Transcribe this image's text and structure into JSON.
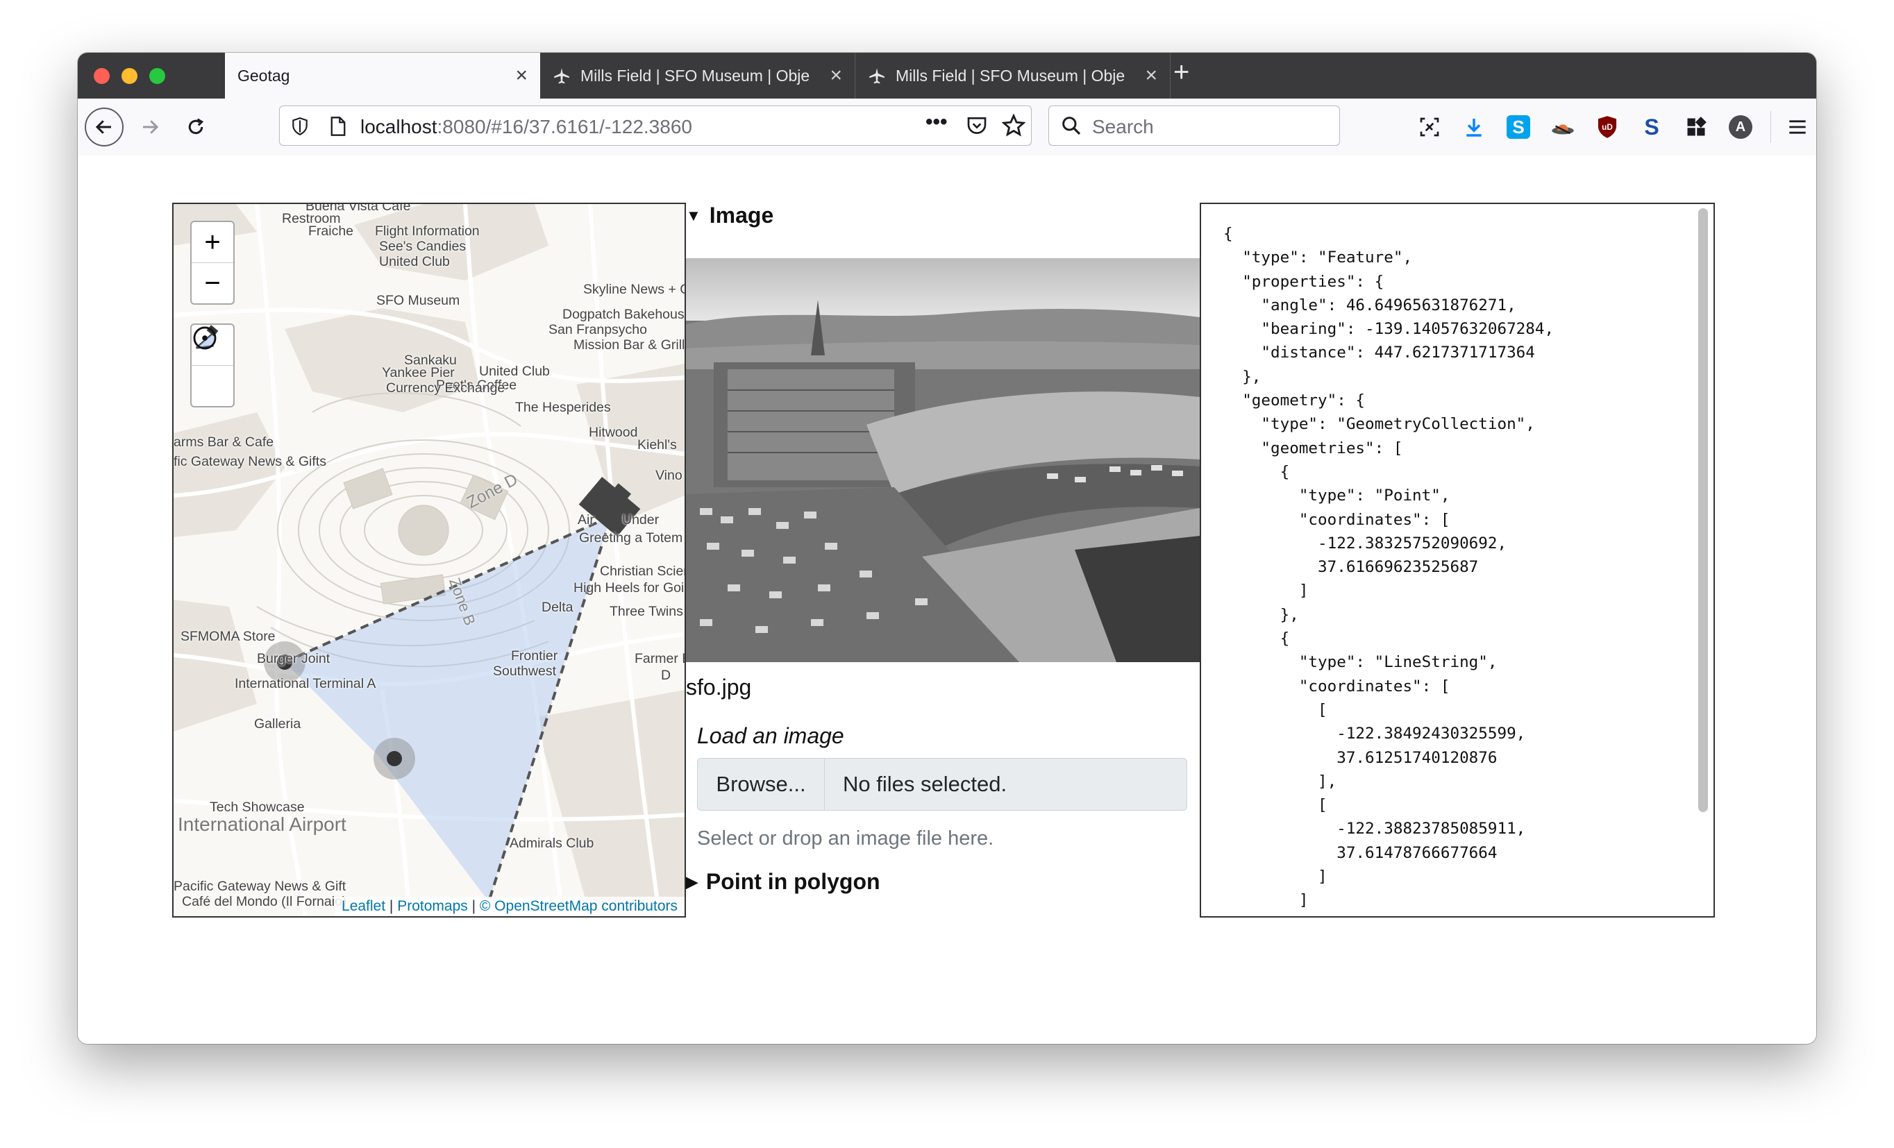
{
  "tabs": [
    {
      "title": "Geotag",
      "active": true
    },
    {
      "title": "Mills Field | SFO Museum | Obje",
      "active": false
    },
    {
      "title": "Mills Field | SFO Museum | Obje",
      "active": false
    }
  ],
  "toolbar": {
    "url_host": "localhost",
    "url_path": ":8080/#16/37.6161/-122.3860",
    "search_placeholder": "Search",
    "extension_icons": [
      "screenshot-icon",
      "download-icon",
      "skype-icon",
      "hat-icon",
      "ublock-icon",
      "s-extension-icon",
      "apps-icon",
      "account-icon",
      "menu-icon"
    ]
  },
  "map": {
    "zoom_in": "+",
    "zoom_out": "−",
    "labels": [
      {
        "text": "Buena Vista Cafe"
      },
      {
        "text": "Restroom"
      },
      {
        "text": "Fraiche"
      },
      {
        "text": "Flight Information"
      },
      {
        "text": "See's Candies"
      },
      {
        "text": "United Club"
      },
      {
        "text": "SFO Museum"
      },
      {
        "text": "Skyline News + Gifts"
      },
      {
        "text": "Dogpatch Bakehouse & C"
      },
      {
        "text": "San Franpsycho"
      },
      {
        "text": "Mission Bar & Grill"
      },
      {
        "text": "Sankaku"
      },
      {
        "text": "Yankee Pier"
      },
      {
        "text": "United Club"
      },
      {
        "text": "Peet's Coffee"
      },
      {
        "text": "Currency Exchange"
      },
      {
        "text": "The Hesperides"
      },
      {
        "text": "arms Bar & Cafe"
      },
      {
        "text": "Hitwood"
      },
      {
        "text": "Kiehl's"
      },
      {
        "text": "fic Gateway News & Gifts"
      },
      {
        "text": "Vino"
      },
      {
        "text": "Air"
      },
      {
        "text": "Under"
      },
      {
        "text": "Greeting a Totem"
      },
      {
        "text": "Christian Science Read"
      },
      {
        "text": "High Heels for Goi"
      },
      {
        "text": "Delta"
      },
      {
        "text": "Three Twins"
      },
      {
        "text": "SFMOMA Store"
      },
      {
        "text": "Farmer B"
      },
      {
        "text": "D"
      },
      {
        "text": "Burger Joint"
      },
      {
        "text": "Frontier"
      },
      {
        "text": "Southwest"
      },
      {
        "text": "International Terminal A"
      },
      {
        "text": "Galleria"
      },
      {
        "text": "Tech Showcase"
      },
      {
        "text": "Admirals Club"
      },
      {
        "text": "Pacific Gateway News & Gift"
      },
      {
        "text": "Café del Mondo (Il Fornaio)"
      }
    ],
    "area_labels": [
      {
        "text": "Zone D"
      },
      {
        "text": "Zone B"
      },
      {
        "text": "International Airport"
      }
    ],
    "attribution": {
      "leaflet": "Leaflet",
      "sep1": " | ",
      "protomaps": "Protomaps",
      "sep2": " | ",
      "osm": "© OpenStreetMap contributors"
    }
  },
  "image_section": {
    "title": "Image",
    "filename": "sfo.jpg",
    "load_label": "Load an image",
    "browse_label": "Browse...",
    "no_files": "No files selected.",
    "help": "Select or drop an image file here."
  },
  "pip_section": {
    "title": "Point in polygon"
  },
  "geojson_lines": [
    "{",
    "  \"type\": \"Feature\",",
    "  \"properties\": {",
    "    \"angle\": 46.64965631876271,",
    "    \"bearing\": -139.14057632067284,",
    "    \"distance\": 447.6217371717364",
    "  },",
    "  \"geometry\": {",
    "    \"type\": \"GeometryCollection\",",
    "    \"geometries\": [",
    "      {",
    "        \"type\": \"Point\",",
    "        \"coordinates\": [",
    "          -122.38325752090692,",
    "          37.61669623525687",
    "        ]",
    "      },",
    "      {",
    "        \"type\": \"LineString\",",
    "        \"coordinates\": [",
    "          [",
    "            -122.38492430325599,",
    "            37.61251740120876",
    "          ],",
    "          [",
    "            -122.38823785085911,",
    "            37.61478766677664",
    "          ]",
    "        ]"
  ]
}
